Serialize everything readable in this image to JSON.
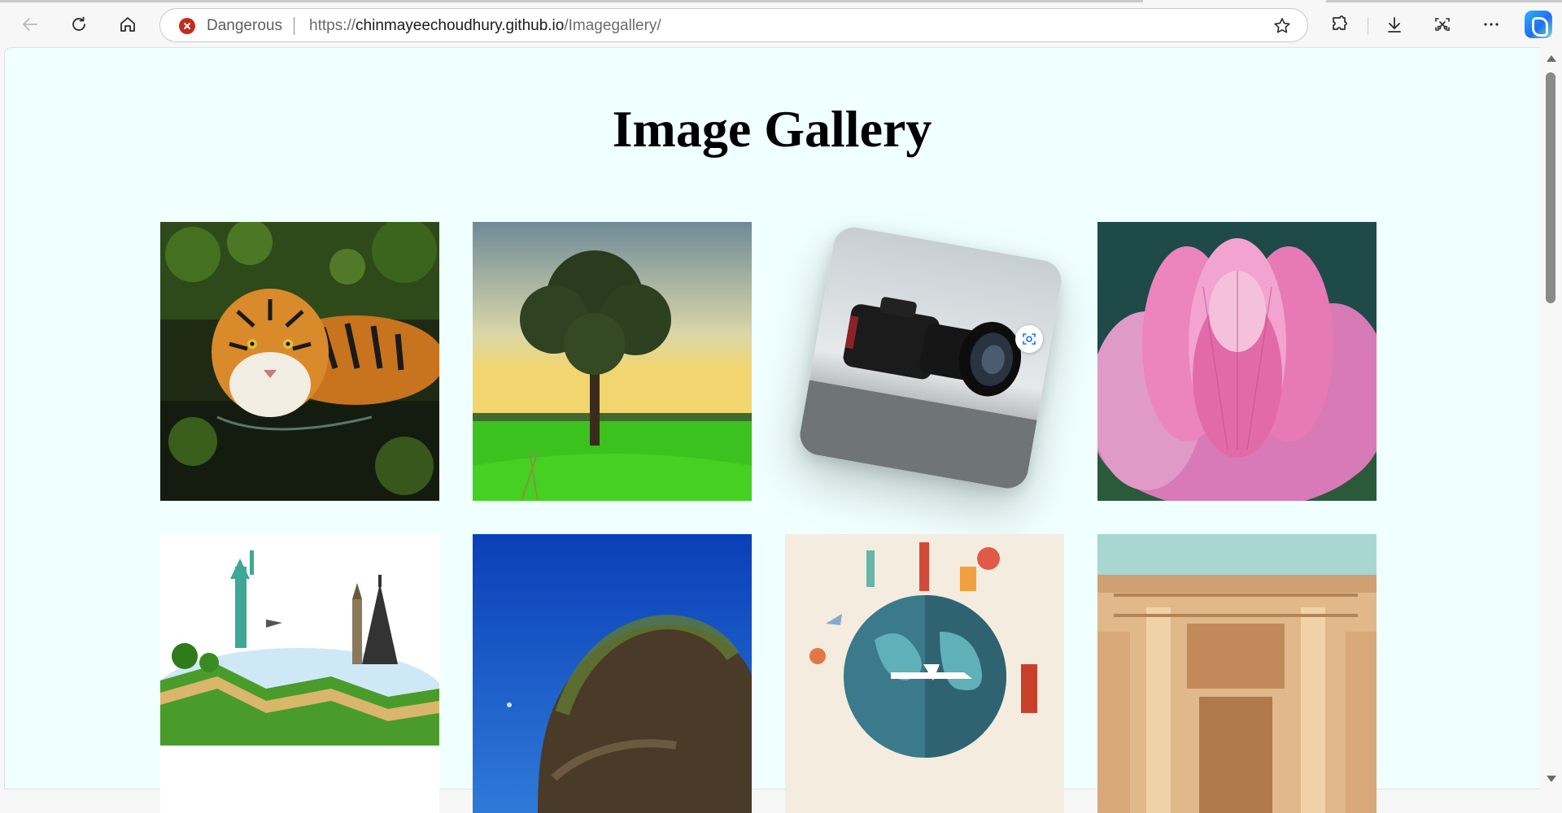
{
  "browser": {
    "security_label": "Dangerous",
    "url_scheme": "https://",
    "url_host": "chinmayeechoudhury.github.io",
    "url_path": "/Imagegallery/",
    "icons": [
      "back-icon",
      "refresh-icon",
      "home-icon",
      "dangerous-site-icon",
      "favorite-star-icon",
      "extensions-icon",
      "downloads-icon",
      "screenshot-icon",
      "more-icon",
      "copilot-icon"
    ]
  },
  "page": {
    "title": "Image Gallery",
    "images": [
      {
        "subject": "tiger"
      },
      {
        "subject": "tree"
      },
      {
        "subject": "camera"
      },
      {
        "subject": "lotus"
      },
      {
        "subject": "world-landmarks"
      },
      {
        "subject": "rock-island"
      },
      {
        "subject": "travel-globe"
      },
      {
        "subject": "ancient-ruins"
      }
    ]
  },
  "colors": {
    "page_background": "#f0ffff",
    "danger": "#c42b1c",
    "title_text": "#000000"
  }
}
